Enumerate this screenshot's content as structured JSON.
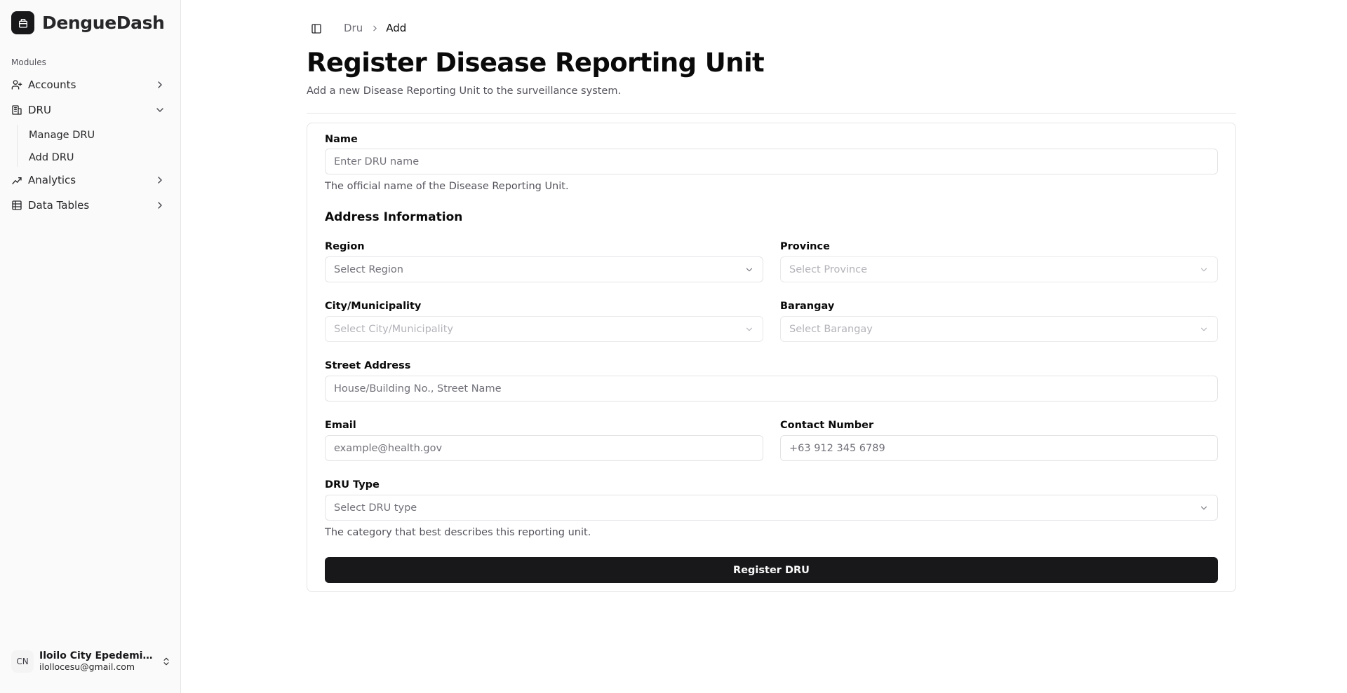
{
  "app": {
    "name": "DengueDash"
  },
  "sidebar": {
    "group_label": "Modules",
    "items": [
      {
        "label": "Accounts",
        "icon": "user-plus-icon",
        "expanded": false
      },
      {
        "label": "DRU",
        "icon": "building-icon",
        "expanded": true,
        "children": [
          {
            "label": "Manage DRU"
          },
          {
            "label": "Add DRU"
          }
        ]
      },
      {
        "label": "Analytics",
        "icon": "chart-line-icon",
        "expanded": false
      },
      {
        "label": "Data Tables",
        "icon": "table-icon",
        "expanded": false
      }
    ],
    "user": {
      "initials": "CN",
      "name": "Iloilo City Epedemiol...",
      "email": "ilollocesu@gmail.com"
    }
  },
  "header": {
    "breadcrumb": [
      "Dru",
      "Add"
    ],
    "title": "Register Disease Reporting Unit",
    "subtitle": "Add a new Disease Reporting Unit to the surveillance system."
  },
  "form": {
    "name": {
      "label": "Name",
      "placeholder": "Enter DRU name",
      "value": "",
      "hint": "The official name of the Disease Reporting Unit."
    },
    "address_section_title": "Address Information",
    "region": {
      "label": "Region",
      "placeholder": "Select Region",
      "disabled": false
    },
    "province": {
      "label": "Province",
      "placeholder": "Select Province",
      "disabled": true
    },
    "city": {
      "label": "City/Municipality",
      "placeholder": "Select City/Municipality",
      "disabled": true
    },
    "barangay": {
      "label": "Barangay",
      "placeholder": "Select Barangay",
      "disabled": true
    },
    "street": {
      "label": "Street Address",
      "placeholder": "House/Building No., Street Name",
      "value": ""
    },
    "email": {
      "label": "Email",
      "placeholder": "example@health.gov",
      "value": ""
    },
    "contact": {
      "label": "Contact Number",
      "placeholder": "+63 912 345 6789",
      "value": ""
    },
    "dru_type": {
      "label": "DRU Type",
      "placeholder": "Select DRU type",
      "hint": "The category that best describes this reporting unit."
    },
    "submit_label": "Register DRU"
  },
  "colors": {
    "primary": "#18181b",
    "border": "#e4e4e7",
    "muted_text": "#71717a",
    "sidebar_bg": "#fafafa"
  }
}
